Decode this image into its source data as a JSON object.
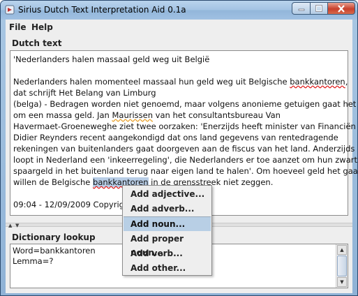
{
  "window": {
    "title": "Sirius Dutch Text Interpretation Aid 0.1a",
    "accent_color": "#b8cde6",
    "close_color": "#c8402c"
  },
  "menubar": {
    "items": [
      "File",
      "Help"
    ]
  },
  "dutch_text": {
    "label": "Dutch text",
    "headline": "'Nederlanders halen massaal geld weg uit België",
    "body": [
      [
        "Nederlanders halen momenteel massaal hun geld weg uit Belgische ",
        "bankkantoren",
        ","
      ],
      [
        "dat schrijft Het Belang van Limburg"
      ],
      [
        "(belga) - Bedragen worden niet genoemd, maar volgens anonieme getuigen gaat het"
      ],
      [
        "om een massa geld. Jan ",
        "Maurissen",
        " van het consultantsbureau Van"
      ],
      [
        "Havermaet-Groeneweghe ziet twee oorzaken: 'Enerzijds heeft minister van Financiën"
      ],
      [
        "Didier Reynders recent aangekondigd dat ons land gegevens van rentedragende"
      ],
      [
        "rekeningen van buitenlanders gaat doorgeven aan de fiscus van het land. Anderzijds"
      ],
      [
        "loopt in Nederland een 'inkeerregeling', die Nederlanders er toe aanzet om hun zwart"
      ],
      [
        "spaargeld in het buitenland terug naar eigen land te halen'. Om hoeveel geld het gaat,"
      ],
      [
        "willen de Belgische ",
        "bankkantoren",
        " in de grensstreek niet zeggen."
      ]
    ],
    "footer": "09:04 - 12/09/2009 Copyright"
  },
  "dictionary_lookup": {
    "label": "Dictionary lookup",
    "lines": [
      "Word=bankkantoren",
      "Lemma=?"
    ]
  },
  "context_menu": {
    "items": [
      "Add adjective...",
      "Add adverb...",
      "Add noun...",
      "Add proper noun...",
      "Add verb...",
      "Add other..."
    ],
    "active_item": "Add noun..."
  },
  "icons": {
    "app": "app-icon",
    "minimize": "minimize-icon",
    "maximize": "maximize-icon",
    "close": "close-icon",
    "splitter_up": "arrow-up-icon",
    "splitter_down": "arrow-down-icon",
    "scroll_up": "scroll-up-icon",
    "scroll_down": "scroll-down-icon"
  }
}
